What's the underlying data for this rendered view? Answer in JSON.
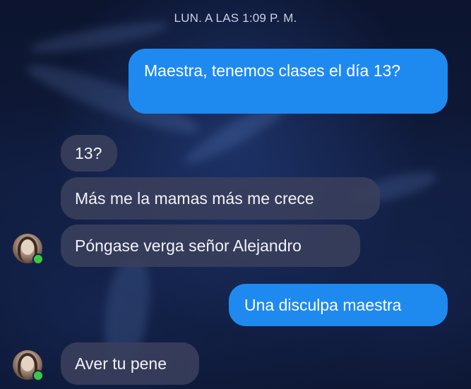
{
  "chat": {
    "timestamp": "LUN. A LAS 1:09 P. M.",
    "messages": [
      {
        "direction": "outgoing",
        "text": "Maestra, tenemos clases el día 13?"
      },
      {
        "direction": "incoming",
        "text": "13?"
      },
      {
        "direction": "incoming",
        "text": "Más me la mamas más me crece"
      },
      {
        "direction": "incoming",
        "text": "Póngase verga señor Alejandro"
      },
      {
        "direction": "outgoing",
        "text": "Una disculpa maestra"
      },
      {
        "direction": "incoming",
        "text": "Aver tu pene"
      }
    ]
  },
  "contact": {
    "avatar_icon": "profile-photo-avatar",
    "online_status_color": "#3ec745"
  },
  "colors": {
    "outgoing_bubble": "#1e8af0",
    "incoming_bubble": "#3a405c",
    "background": "#0d1530"
  }
}
